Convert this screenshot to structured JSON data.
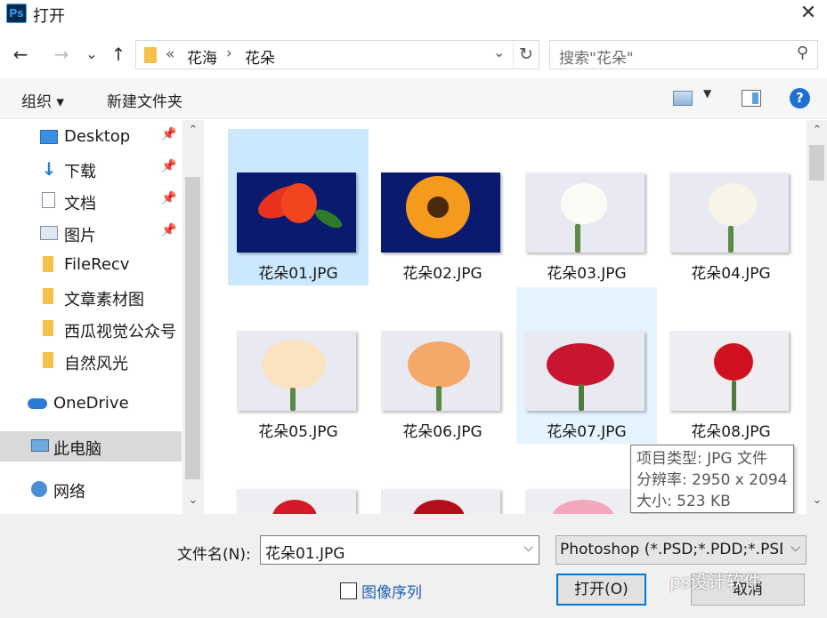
{
  "titlebar": {
    "logo": "Ps",
    "title": "打开",
    "close": "✕"
  },
  "nav": {
    "back": "←",
    "forward": "→",
    "recent": "⌄",
    "up": "↑",
    "breadcrumb": {
      "overflow": "«",
      "seg1": "花海",
      "sep": "›",
      "seg2": "花朵"
    },
    "address_dropdown": "⌄",
    "refresh": "↻",
    "search_placeholder": "搜索\"花朵\"",
    "search_icon": "⚲"
  },
  "toolbar": {
    "organize": "组织 ▾",
    "new_folder": "新建文件夹",
    "view_dropdown": "▼",
    "help": "?"
  },
  "sidebar": {
    "items": [
      {
        "label": "Desktop",
        "icon": "desktop-icon",
        "pinned": true
      },
      {
        "label": "下载",
        "icon": "download-icon",
        "pinned": true
      },
      {
        "label": "文档",
        "icon": "document-icon",
        "pinned": true
      },
      {
        "label": "图片",
        "icon": "pictures-icon",
        "pinned": true
      },
      {
        "label": "FileRecv",
        "icon": "folder-icon",
        "pinned": false
      },
      {
        "label": "文章素材图",
        "icon": "folder-icon",
        "pinned": false
      },
      {
        "label": "西瓜视觉公众号",
        "icon": "folder-icon",
        "pinned": false
      },
      {
        "label": "自然风光",
        "icon": "folder-icon",
        "pinned": false
      },
      {
        "label": "OneDrive",
        "icon": "cloud-icon",
        "pinned": false
      },
      {
        "label": "此电脑",
        "icon": "pc-icon",
        "pinned": false
      },
      {
        "label": "网络",
        "icon": "network-icon",
        "pinned": false
      }
    ],
    "pin_glyph": "📌"
  },
  "files": [
    {
      "name": "花朵01.JPG"
    },
    {
      "name": "花朵02.JPG"
    },
    {
      "name": "花朵03.JPG"
    },
    {
      "name": "花朵04.JPG"
    },
    {
      "name": "花朵05.JPG"
    },
    {
      "name": "花朵06.JPG"
    },
    {
      "name": "花朵07.JPG"
    },
    {
      "name": "花朵08.JPG"
    }
  ],
  "tooltip": {
    "type": "项目类型: JPG 文件",
    "dimensions": "分辨率: 2950 x 2094",
    "size": "大小: 523 KB"
  },
  "bottom": {
    "filename_label": "文件名(N):",
    "filename_value": "花朵01.JPG",
    "filetype_value": "Photoshop (*.PSD;*.PDD;*.PSD",
    "dropdown": "⌵",
    "image_sequence": "图像序列",
    "open_button": "打开(O)",
    "cancel_button": "取消",
    "watermark": "ps设计软件"
  },
  "scroll": {
    "up": "⌃",
    "down": "⌄"
  },
  "colors": {
    "selection": "#cce8ff",
    "hover": "#e5f3ff",
    "accent": "#0078d7",
    "folder": "#f4c14b"
  }
}
